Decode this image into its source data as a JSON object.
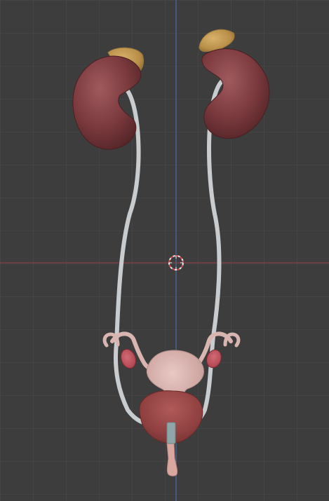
{
  "viewport": {
    "background": "#3d3d3d",
    "grid_color": "#4a4a4a",
    "x_axis_color": "#9a3d46",
    "y_axis_color": "#4a73b3"
  },
  "scene": {
    "objects": [
      "left-kidney",
      "right-kidney",
      "left-adrenal-gland",
      "right-adrenal-gland",
      "left-ureter",
      "right-ureter",
      "uterus",
      "left-fallopian-tube",
      "right-fallopian-tube",
      "left-ovary",
      "right-ovary",
      "bladder",
      "urethra"
    ],
    "colors": {
      "kidney": "#7b3a3e",
      "adrenal": "#c7a15a",
      "ureter": "#c9cccf",
      "uterus": "#d8b6b3",
      "ovary": "#b44a55",
      "bladder": "#8e3f3f",
      "urethra": "#d9a6a0",
      "marker": "#8fa6a8"
    },
    "cursor_icon": "3d-cursor-icon"
  }
}
